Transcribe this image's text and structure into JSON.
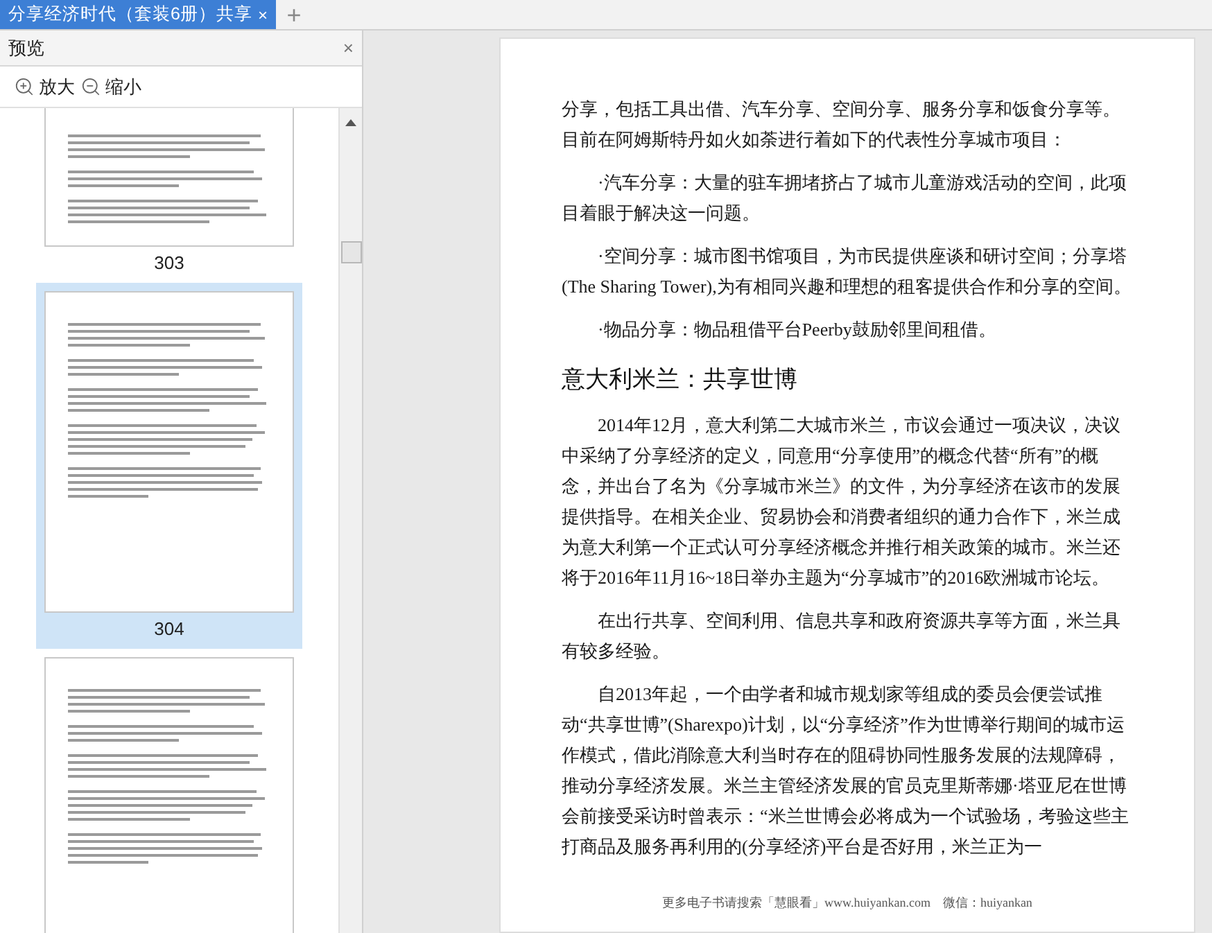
{
  "tabs": [
    {
      "title": "分享经济时代（套装6册）共享",
      "close": "×",
      "selected": true
    }
  ],
  "new_tab": "+",
  "preview_panel": {
    "title": "预览",
    "close": "×",
    "zoom_in": "放大",
    "zoom_out": "缩小",
    "thumbnails": [
      {
        "page": "303",
        "selected": false
      },
      {
        "page": "304",
        "selected": true
      },
      {
        "selected": false
      }
    ]
  },
  "document": {
    "blocks": [
      {
        "kind": "continuation",
        "text": "分享，包括工具出借、汽车分享、空间分享、服务分享和饭食分享等。目前在阿姆斯特丹如火如荼进行着如下的代表性分享城市项目："
      },
      {
        "kind": "paragraph",
        "text": "·汽车分享：大量的驻车拥堵挤占了城市儿童游戏活动的空间，此项目着眼于解决这一问题。"
      },
      {
        "kind": "paragraph",
        "text": "·空间分享：城市图书馆项目，为市民提供座谈和研讨空间；分享塔(The Sharing Tower),为有相同兴趣和理想的租客提供合作和分享的空间。"
      },
      {
        "kind": "paragraph",
        "text": "·物品分享：物品租借平台Peerby鼓励邻里间租借。"
      },
      {
        "kind": "heading",
        "text": "意大利米兰：共享世博"
      },
      {
        "kind": "paragraph",
        "text": "2014年12月，意大利第二大城市米兰，市议会通过一项决议，决议中采纳了分享经济的定义，同意用“分享使用”的概念代替“所有”的概念，并出台了名为《分享城市米兰》的文件，为分享经济在该市的发展提供指导。在相关企业、贸易协会和消费者组织的通力合作下，米兰成为意大利第一个正式认可分享经济概念并推行相关政策的城市。米兰还将于2016年11月16~18日举办主题为“分享城市”的2016欧洲城市论坛。"
      },
      {
        "kind": "paragraph",
        "text": "在出行共享、空间利用、信息共享和政府资源共享等方面，米兰具有较多经验。"
      },
      {
        "kind": "paragraph",
        "text": "自2013年起，一个由学者和城市规划家等组成的委员会便尝试推动“共享世博”(Sharexpo)计划，以“分享经济”作为世博举行期间的城市运作模式，借此消除意大利当时存在的阻碍协同性服务发展的法规障碍，推动分享经济发展。米兰主管经济发展的官员克里斯蒂娜·塔亚尼在世博会前接受采访时曾表示：“米兰世博会必将成为一个试验场，考验这些主打商品及服务再利用的(分享经济)平台是否好用，米兰正为一"
      }
    ],
    "footer": "更多电子书请搜索「慧眼看」www.huiyankan.com　微信：huiyankan"
  }
}
